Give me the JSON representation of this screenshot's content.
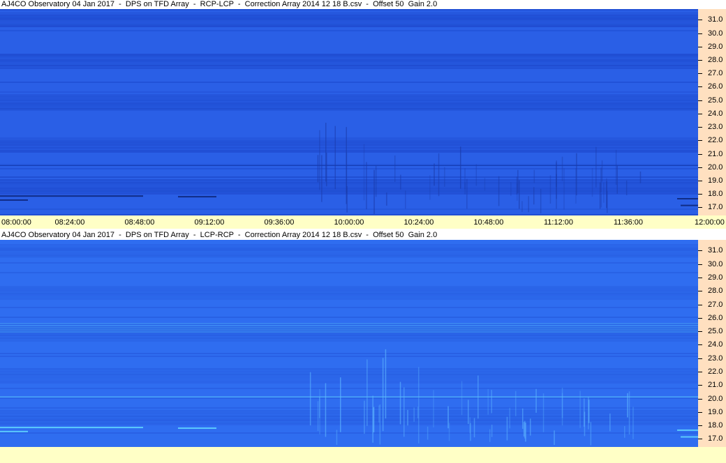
{
  "chart_data": [
    {
      "type": "heatmap",
      "title": "AJ4CO Observatory 04 Jan 2017  -  DPS on TFD Array  -  RCP-LCP  -  Correction Array 2014 12 18 B.csv  -  Offset 50  Gain 2.0",
      "x_tick_labels": [
        "08:00:00",
        "08:24:00",
        "08:48:00",
        "09:12:00",
        "09:36:00",
        "10:00:00",
        "10:24:00",
        "10:48:00",
        "11:12:00",
        "11:36:00",
        "12:00:00"
      ],
      "y_tick_labels": [
        "31.0",
        "30.0",
        "29.0",
        "28.0",
        "27.0",
        "26.0",
        "25.0",
        "24.0",
        "23.0",
        "22.0",
        "21.0",
        "20.0",
        "19.0",
        "18.0",
        "17.0"
      ],
      "x_range": [
        "08:00:00",
        "12:00:00"
      ],
      "y_range": [
        16.4,
        31.8
      ],
      "colors": {
        "base": "#2a5fe6",
        "dark_band": "#1a44c8",
        "bright": "#58c8ff"
      }
    },
    {
      "type": "heatmap",
      "title": "AJ4CO Observatory 04 Jan 2017  -  DPS on TFD Array  -  LCP-RCP  -  Correction Array 2014 12 18 B.csv  -  Offset 50  Gain 2.0",
      "x_tick_labels": [],
      "y_tick_labels": [
        "31.0",
        "30.0",
        "29.0",
        "28.0",
        "27.0",
        "26.0",
        "25.0",
        "24.0",
        "23.0",
        "22.0",
        "21.0",
        "20.0",
        "19.0",
        "18.0",
        "17.0"
      ],
      "x_range": [
        "08:00:00",
        "12:00:00"
      ],
      "y_range": [
        16.4,
        31.8
      ],
      "colors": {
        "base": "#2f6df0",
        "dark_band": "#2458dc",
        "bright": "#66e0ff"
      }
    }
  ]
}
